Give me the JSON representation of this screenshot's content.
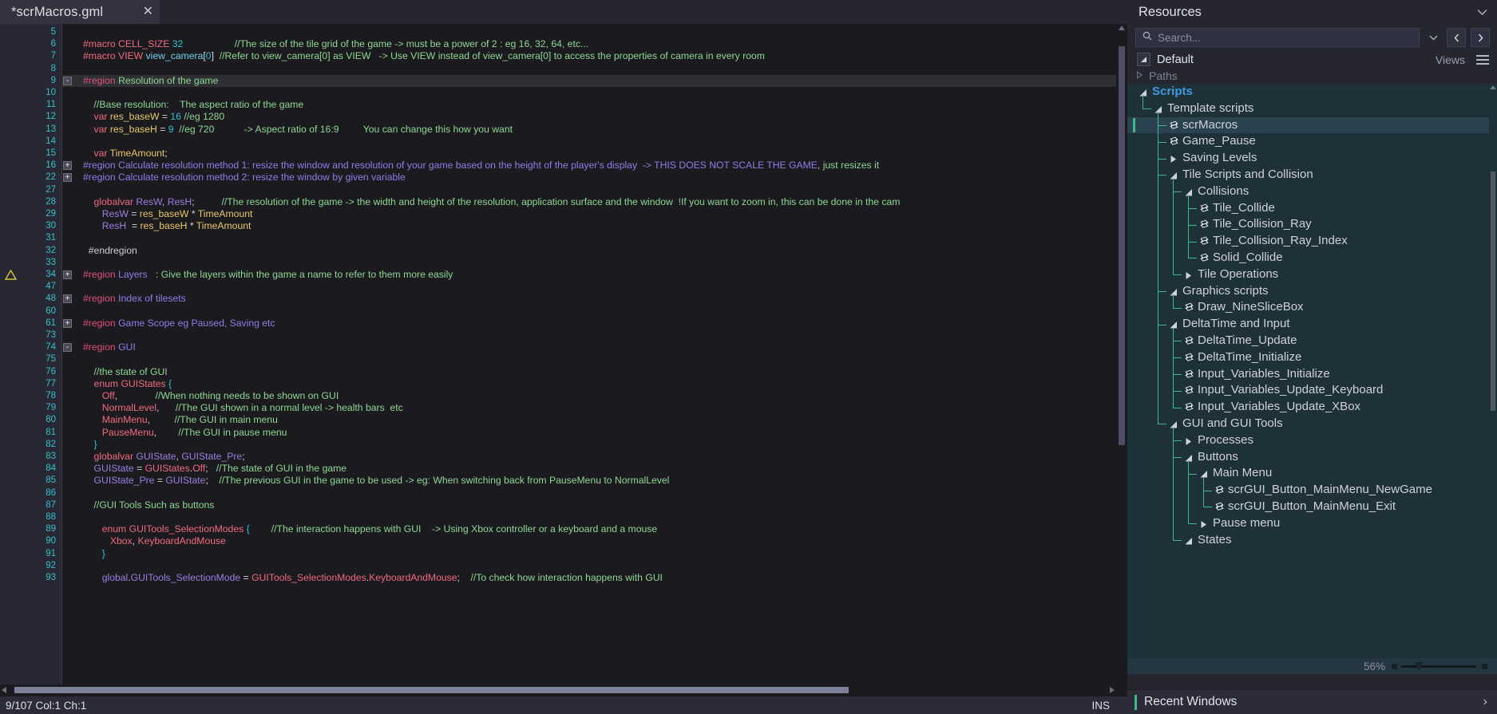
{
  "editor": {
    "tab": {
      "title": "*scrMacros.gml",
      "close_label": "✕"
    },
    "status": {
      "position": "9/107 Col:1 Ch:1",
      "insert_mode": "INS"
    },
    "lines": [
      {
        "n": "5",
        "fold": "",
        "warn": false,
        "html": ""
      },
      {
        "n": "6",
        "fold": "",
        "warn": false,
        "html": "<span class='c-mac'>#macro</span> <span class='c-pink'>CELL_SIZE</span> <span class='c-num'>32</span>                   <span class='c-cmt'>//The size of the tile grid of the game -&gt; must be a power of 2 : eg 16, 32, 64, etc...</span>"
      },
      {
        "n": "7",
        "fold": "",
        "warn": false,
        "html": "<span class='c-mac'>#macro</span> <span class='c-pink'>VIEW</span> <span class='c-fn'>view_camera</span><span class='c-plain'>[</span><span class='c-num'>0</span><span class='c-plain'>]</span>  <span class='c-cmt'>//Refer to view_camera[0] as VIEW   -&gt; Use VIEW instead of view_camera[0] to access the properties of camera in every room</span>"
      },
      {
        "n": "8",
        "fold": "",
        "warn": false,
        "html": ""
      },
      {
        "n": "9",
        "fold": "-",
        "warn": false,
        "hl": true,
        "html": "<span class='c-regkw'>#region</span> <span class='c-cmt'>Resolution of the game</span>"
      },
      {
        "n": "10",
        "fold": "",
        "warn": false,
        "html": ""
      },
      {
        "n": "11",
        "fold": "",
        "warn": false,
        "html": "    <span class='c-cmt'>//Base resolution:    The aspect ratio of the game</span>"
      },
      {
        "n": "12",
        "fold": "",
        "warn": false,
        "html": "    <span class='c-kw'>var</span> <span class='c-var'>res_baseW</span> <span class='c-plain'>=</span> <span class='c-num'>16</span> <span class='c-cmt'>//eg 1280</span>"
      },
      {
        "n": "13",
        "fold": "",
        "warn": false,
        "html": "    <span class='c-kw'>var</span> <span class='c-var'>res_baseH</span> <span class='c-plain'>=</span> <span class='c-num'>9</span>  <span class='c-cmt'>//eg 720           -&gt; Aspect ratio of 16:9         You can change this how you want</span>"
      },
      {
        "n": "14",
        "fold": "",
        "warn": false,
        "html": ""
      },
      {
        "n": "15",
        "fold": "",
        "warn": false,
        "html": "    <span class='c-kw'>var</span> <span class='c-var'>TimeAmount</span><span class='c-plain'>;</span>"
      },
      {
        "n": "16",
        "fold": "+",
        "warn": false,
        "html": "<span class='c-reg'>#region Calculate resolution method 1: resize the window and resolution of your game based on the height of the player's display  -&gt; THIS DOES NOT SCALE THE GAME</span><span class='c-cmt'>, just resizes it</span>"
      },
      {
        "n": "22",
        "fold": "+",
        "warn": false,
        "html": "<span class='c-reg'>#region Calculate resolution method 2: resize the window by given variable</span>"
      },
      {
        "n": "27",
        "fold": "",
        "warn": false,
        "html": ""
      },
      {
        "n": "28",
        "fold": "",
        "warn": false,
        "html": "    <span class='c-kw'>globalvar</span> <span class='c-glob'>ResW</span><span class='c-plain'>,</span> <span class='c-glob'>ResH</span><span class='c-plain'>;</span>          <span class='c-cmt'>//The resolution of the game -&gt; the width and height of the resolution, application surface and the window  !If you want to zoom in, this can be done in the cam</span>"
      },
      {
        "n": "29",
        "fold": "",
        "warn": false,
        "html": "       <span class='c-glob'>ResW</span> <span class='c-plain'>=</span> <span class='c-var'>res_baseW</span> <span class='c-plain'>*</span> <span class='c-var'>TimeAmount</span>"
      },
      {
        "n": "30",
        "fold": "",
        "warn": false,
        "html": "       <span class='c-glob'>ResH</span>  <span class='c-plain'>=</span> <span class='c-var'>res_baseH</span> <span class='c-plain'>*</span> <span class='c-var'>TimeAmount</span>"
      },
      {
        "n": "31",
        "fold": "",
        "warn": false,
        "html": ""
      },
      {
        "n": "32",
        "fold": "",
        "warn": false,
        "html": "  <span class='c-white'>#endregion</span>"
      },
      {
        "n": "33",
        "fold": "",
        "warn": false,
        "html": ""
      },
      {
        "n": "34",
        "fold": "+",
        "warn": true,
        "html": "<span class='c-regkw'>#region</span> <span class='c-reg'>Layers</span>   <span class='c-cmt'>: Give the layers within the game a name to refer to them more easily</span>"
      },
      {
        "n": "47",
        "fold": "",
        "warn": false,
        "html": ""
      },
      {
        "n": "48",
        "fold": "+",
        "warn": false,
        "html": "<span class='c-regkw'>#region</span> <span class='c-reg'>Index of tilesets</span>"
      },
      {
        "n": "60",
        "fold": "",
        "warn": false,
        "html": ""
      },
      {
        "n": "61",
        "fold": "+",
        "warn": false,
        "html": "<span class='c-regkw'>#region</span> <span class='c-reg'>Game Scope eg Paused, Saving etc</span>"
      },
      {
        "n": "73",
        "fold": "",
        "warn": false,
        "html": ""
      },
      {
        "n": "74",
        "fold": "-",
        "warn": false,
        "html": "<span class='c-regkw'>#region</span> <span class='c-reg'>GUI</span>"
      },
      {
        "n": "75",
        "fold": "",
        "warn": false,
        "html": ""
      },
      {
        "n": "76",
        "fold": "",
        "warn": false,
        "html": "    <span class='c-cmt'>//the state of GUI</span>"
      },
      {
        "n": "77",
        "fold": "",
        "warn": false,
        "html": "    <span class='c-kw'>enum</span> <span class='c-pink'>GUIStates</span> <span class='c-brc'>{</span>"
      },
      {
        "n": "78",
        "fold": "",
        "warn": false,
        "html": "       <span class='c-pink'>Off</span><span class='c-plain'>,</span>              <span class='c-cmt'>//When nothing needs to be shown on GUI</span>"
      },
      {
        "n": "79",
        "fold": "",
        "warn": false,
        "html": "       <span class='c-pink'>NormalLevel</span><span class='c-plain'>,</span>      <span class='c-cmt'>//The GUI shown in a normal level -&gt; health bars  etc</span>"
      },
      {
        "n": "80",
        "fold": "",
        "warn": false,
        "html": "       <span class='c-pink'>MainMenu</span><span class='c-plain'>,</span>         <span class='c-cmt'>//The GUI in main menu</span>"
      },
      {
        "n": "81",
        "fold": "",
        "warn": false,
        "html": "       <span class='c-pink'>PauseMenu</span><span class='c-plain'>,</span>        <span class='c-cmt'>//The GUI in pause menu</span>"
      },
      {
        "n": "82",
        "fold": "",
        "warn": false,
        "html": "    <span class='c-brc'>}</span>"
      },
      {
        "n": "83",
        "fold": "",
        "warn": false,
        "html": "    <span class='c-kw'>globalvar</span> <span class='c-glob'>GUIState</span><span class='c-plain'>,</span> <span class='c-glob'>GUIState_Pre</span><span class='c-plain'>;</span>"
      },
      {
        "n": "84",
        "fold": "",
        "warn": false,
        "html": "    <span class='c-glob'>GUIState</span> <span class='c-plain'>=</span> <span class='c-pink'>GUIStates</span><span class='c-plain'>.</span><span class='c-pink'>Off</span><span class='c-plain'>;</span>   <span class='c-cmt'>//The state of GUI in the game</span>"
      },
      {
        "n": "85",
        "fold": "",
        "warn": false,
        "html": "    <span class='c-glob'>GUIState_Pre</span> <span class='c-plain'>=</span> <span class='c-glob'>GUIState</span><span class='c-plain'>;</span>    <span class='c-cmt'>//The previous GUI in the game to be used -&gt; eg: When switching back from PauseMenu to NormalLevel</span>"
      },
      {
        "n": "86",
        "fold": "",
        "warn": false,
        "html": ""
      },
      {
        "n": "87",
        "fold": "",
        "warn": false,
        "html": "    <span class='c-cmt'>//GUI Tools Such as buttons</span>"
      },
      {
        "n": "88",
        "fold": "",
        "warn": false,
        "html": ""
      },
      {
        "n": "89",
        "fold": "",
        "warn": false,
        "html": "       <span class='c-kw'>enum</span> <span class='c-pink'>GUITools_SelectionModes</span> <span class='c-brc'>{</span>        <span class='c-cmt'>//The interaction happens with GUI    -&gt; Using Xbox controller or a keyboard and a mouse</span>"
      },
      {
        "n": "90",
        "fold": "",
        "warn": false,
        "html": "          <span class='c-pink'>Xbox</span><span class='c-plain'>,</span> <span class='c-pink'>KeyboardAndMouse</span>"
      },
      {
        "n": "91",
        "fold": "",
        "warn": false,
        "html": "       <span class='c-brc'>}</span>"
      },
      {
        "n": "92",
        "fold": "",
        "warn": false,
        "html": ""
      },
      {
        "n": "93",
        "fold": "",
        "warn": false,
        "html": "       <span class='c-glob'>global</span><span class='c-plain'>.</span><span class='c-glob'>GUITools_SelectionMode</span> <span class='c-plain'>=</span> <span class='c-pink'>GUITools_SelectionModes</span><span class='c-plain'>.</span><span class='c-pink'>KeyboardAndMouse</span><span class='c-plain'>;</span>    <span class='c-cmt'>//To check how interaction happens with GUI</span>"
      }
    ]
  },
  "resources": {
    "title": "Resources",
    "collapse_icon": "chevron-down",
    "search": {
      "placeholder": "Search...",
      "value": ""
    },
    "nav": {
      "back": "‹",
      "forward": "›",
      "dropdown": "⌄"
    },
    "subheader": {
      "default_label": "Default",
      "views_label": "Views"
    },
    "paths": {
      "label": "Paths"
    },
    "zoom": {
      "percent": "56%"
    },
    "tree": [
      {
        "depth": 0,
        "label": "Scripts",
        "type": "folder",
        "state": "open",
        "sel": false,
        "accent": true
      },
      {
        "depth": 1,
        "label": "Template scripts",
        "type": "folder",
        "state": "open",
        "sel": false
      },
      {
        "depth": 2,
        "label": "scrMacros",
        "type": "script",
        "state": "leaf",
        "sel": true
      },
      {
        "depth": 2,
        "label": "Game_Pause",
        "type": "script",
        "state": "leaf",
        "sel": false
      },
      {
        "depth": 2,
        "label": "Saving Levels",
        "type": "folder",
        "state": "closed",
        "sel": false
      },
      {
        "depth": 2,
        "label": "Tile Scripts and Collision",
        "type": "folder",
        "state": "open",
        "sel": false
      },
      {
        "depth": 3,
        "label": "Collisions",
        "type": "folder",
        "state": "open",
        "sel": false
      },
      {
        "depth": 4,
        "label": "Tile_Collide",
        "type": "script",
        "state": "leaf",
        "sel": false
      },
      {
        "depth": 4,
        "label": "Tile_Collision_Ray",
        "type": "script",
        "state": "leaf",
        "sel": false
      },
      {
        "depth": 4,
        "label": "Tile_Collision_Ray_Index",
        "type": "script",
        "state": "leaf",
        "sel": false
      },
      {
        "depth": 4,
        "label": "Solid_Collide",
        "type": "script",
        "state": "leaf",
        "sel": false
      },
      {
        "depth": 3,
        "label": "Tile Operations",
        "type": "folder",
        "state": "closed",
        "sel": false
      },
      {
        "depth": 2,
        "label": "Graphics scripts",
        "type": "folder",
        "state": "open",
        "sel": false
      },
      {
        "depth": 3,
        "label": "Draw_NineSliceBox",
        "type": "script",
        "state": "leaf",
        "sel": false
      },
      {
        "depth": 2,
        "label": "DeltaTime and Input",
        "type": "folder",
        "state": "open",
        "sel": false
      },
      {
        "depth": 3,
        "label": "DeltaTime_Update",
        "type": "script",
        "state": "leaf",
        "sel": false
      },
      {
        "depth": 3,
        "label": "DeltaTime_Initialize",
        "type": "script",
        "state": "leaf",
        "sel": false
      },
      {
        "depth": 3,
        "label": "Input_Variables_Initialize",
        "type": "script",
        "state": "leaf",
        "sel": false
      },
      {
        "depth": 3,
        "label": "Input_Variables_Update_Keyboard",
        "type": "script",
        "state": "leaf",
        "sel": false
      },
      {
        "depth": 3,
        "label": "Input_Variables_Update_XBox",
        "type": "script",
        "state": "leaf",
        "sel": false
      },
      {
        "depth": 2,
        "label": "GUI and GUI Tools",
        "type": "folder",
        "state": "open",
        "sel": false
      },
      {
        "depth": 3,
        "label": "Processes",
        "type": "folder",
        "state": "closed",
        "sel": false
      },
      {
        "depth": 3,
        "label": "Buttons",
        "type": "folder",
        "state": "open",
        "sel": false
      },
      {
        "depth": 4,
        "label": "Main Menu",
        "type": "folder",
        "state": "open",
        "sel": false
      },
      {
        "depth": 5,
        "label": "scrGUI_Button_MainMenu_NewGame",
        "type": "script",
        "state": "leaf",
        "sel": false
      },
      {
        "depth": 5,
        "label": "scrGUI_Button_MainMenu_Exit",
        "type": "script",
        "state": "leaf",
        "sel": false
      },
      {
        "depth": 4,
        "label": "Pause menu",
        "type": "folder",
        "state": "closed",
        "sel": false
      },
      {
        "depth": 3,
        "label": "States",
        "type": "folder",
        "state": "open",
        "sel": false
      }
    ]
  },
  "recent_windows": {
    "label": "Recent Windows",
    "chevron": "›"
  }
}
